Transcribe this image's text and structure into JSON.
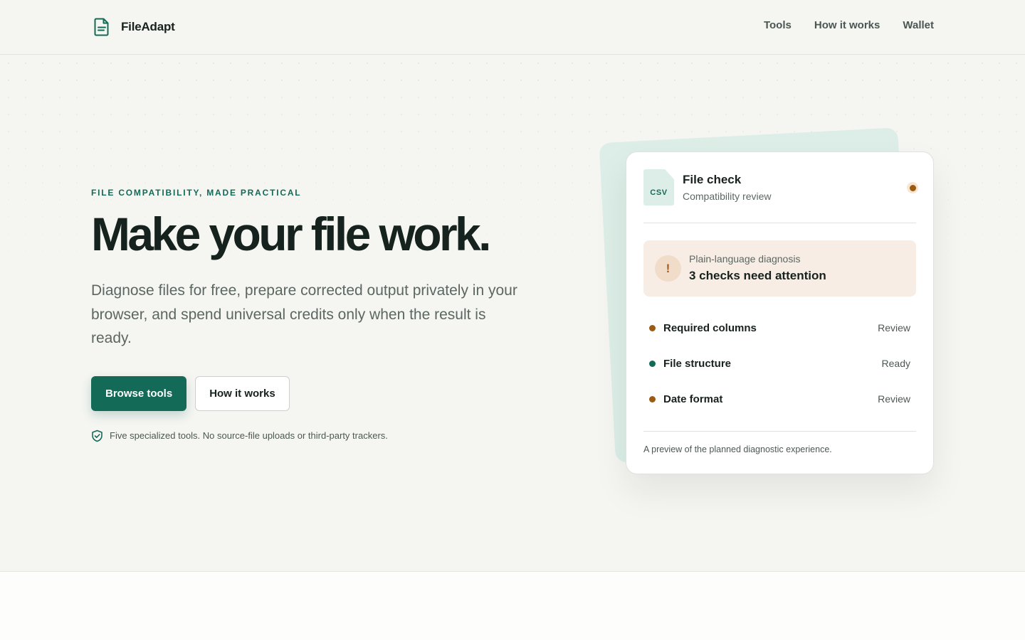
{
  "brand": {
    "name": "FileAdapt",
    "icon": "document-icon"
  },
  "nav": {
    "items": [
      "Tools",
      "How it works",
      "Wallet"
    ]
  },
  "hero": {
    "eyebrow": "FILE COMPATIBILITY, MADE PRACTICAL",
    "title": "Make your file work.",
    "lede": "Diagnose files for free, prepare corrected output privately in your browser, and spend universal credits only when the result is ready.",
    "primary_cta": "Browse tools",
    "secondary_cta": "How it works",
    "note": "Five specialized tools. No source-file uploads or third-party trackers.",
    "note_icon": "shield-check-icon"
  },
  "card": {
    "file_type": "CSV",
    "title": "File check",
    "subtitle": "Compatibility review",
    "diagnosis_label": "Plain-language diagnosis",
    "diagnosis_value": "3 checks need attention",
    "diagnosis_icon": "!",
    "checks": [
      {
        "name": "Required columns",
        "status": "Review",
        "color": "#9c5a12"
      },
      {
        "name": "File structure",
        "status": "Ready",
        "color": "#136a56"
      },
      {
        "name": "Date format",
        "status": "Review",
        "color": "#9c5a12"
      }
    ],
    "footnote": "A preview of the planned diagnostic experience."
  },
  "colors": {
    "accent": "#136a56",
    "warning": "#9c5a12",
    "background": "#f5f5f2"
  }
}
